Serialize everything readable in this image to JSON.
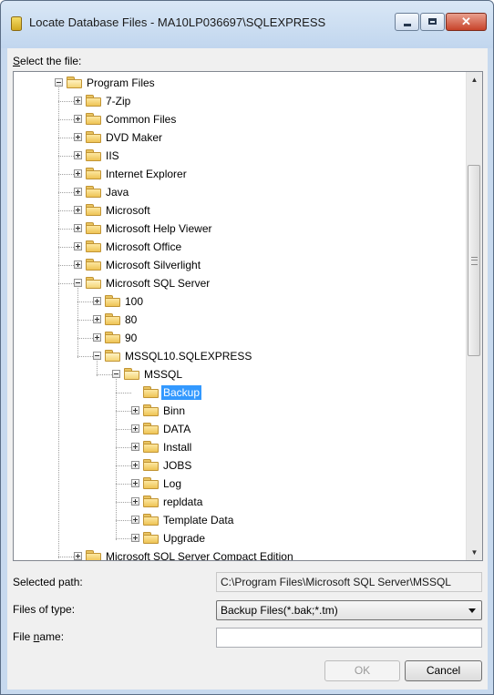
{
  "window": {
    "title": "Locate Database Files - MA10LP036697\\SQLEXPRESS",
    "close_glyph": "✕"
  },
  "dialog": {
    "select_label_key": "S",
    "select_label_rest": "elect the file:",
    "selected_path_label": "Selected path:",
    "selected_path_value": "C:\\Program Files\\Microsoft SQL Server\\MSSQL",
    "files_of_type_label": "Files of type:",
    "files_of_type_value": "Backup Files(*.bak;*.tm)",
    "file_name_label_pre": "File ",
    "file_name_label_key": "n",
    "file_name_label_rest": "ame:",
    "file_name_value": "",
    "ok_label": "OK",
    "cancel_label": "Cancel"
  },
  "tree": {
    "nodes": [
      {
        "label": "Program Files",
        "depth": 0,
        "expander": "minus"
      },
      {
        "label": "7-Zip",
        "depth": 1,
        "expander": "plus"
      },
      {
        "label": "Common Files",
        "depth": 1,
        "expander": "plus"
      },
      {
        "label": "DVD Maker",
        "depth": 1,
        "expander": "plus"
      },
      {
        "label": "IIS",
        "depth": 1,
        "expander": "plus"
      },
      {
        "label": "Internet Explorer",
        "depth": 1,
        "expander": "plus"
      },
      {
        "label": "Java",
        "depth": 1,
        "expander": "plus"
      },
      {
        "label": "Microsoft",
        "depth": 1,
        "expander": "plus"
      },
      {
        "label": "Microsoft Help Viewer",
        "depth": 1,
        "expander": "plus"
      },
      {
        "label": "Microsoft Office",
        "depth": 1,
        "expander": "plus"
      },
      {
        "label": "Microsoft Silverlight",
        "depth": 1,
        "expander": "plus"
      },
      {
        "label": "Microsoft SQL Server",
        "depth": 1,
        "expander": "minus"
      },
      {
        "label": "100",
        "depth": 2,
        "expander": "plus"
      },
      {
        "label": "80",
        "depth": 2,
        "expander": "plus"
      },
      {
        "label": "90",
        "depth": 2,
        "expander": "plus"
      },
      {
        "label": "MSSQL10.SQLEXPRESS",
        "depth": 2,
        "expander": "minus"
      },
      {
        "label": "MSSQL",
        "depth": 3,
        "expander": "minus"
      },
      {
        "label": "Backup",
        "depth": 4,
        "expander": "none",
        "selected": true
      },
      {
        "label": "Binn",
        "depth": 4,
        "expander": "plus"
      },
      {
        "label": "DATA",
        "depth": 4,
        "expander": "plus"
      },
      {
        "label": "Install",
        "depth": 4,
        "expander": "plus"
      },
      {
        "label": "JOBS",
        "depth": 4,
        "expander": "plus"
      },
      {
        "label": "Log",
        "depth": 4,
        "expander": "plus"
      },
      {
        "label": "repldata",
        "depth": 4,
        "expander": "plus"
      },
      {
        "label": "Template Data",
        "depth": 4,
        "expander": "plus"
      },
      {
        "label": "Upgrade",
        "depth": 4,
        "expander": "plus"
      },
      {
        "label": "Microsoft SQL Server Compact Edition",
        "depth": 1,
        "expander": "plus"
      }
    ],
    "scroll_up_glyph": "▲",
    "scroll_down_glyph": "▼"
  }
}
